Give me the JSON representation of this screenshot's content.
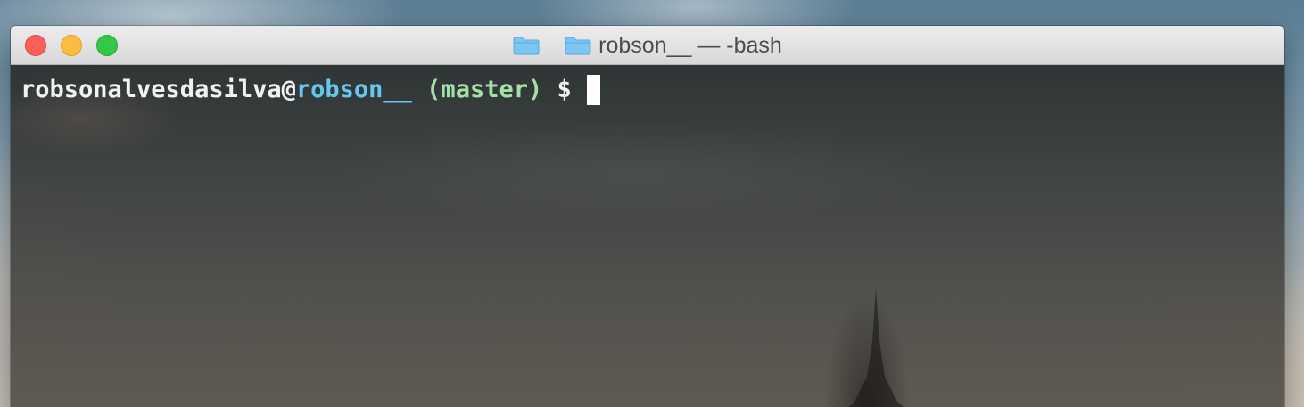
{
  "window": {
    "title": "robson__ — -bash",
    "buttons": {
      "close": "close",
      "minimize": "minimize",
      "zoom": "zoom"
    },
    "icons": {
      "proxy": "folder-icon",
      "title": "folder-icon"
    }
  },
  "prompt": {
    "user": "robsonalvesdasilva",
    "at": "@",
    "host": "robson__",
    "branch": " (master)",
    "symbol": " $ "
  },
  "colors": {
    "host": "#66c7ee",
    "branch": "#a3e0a8",
    "text": "#f2f2f2",
    "folder": "#7cc6f2",
    "close": "#fc605b",
    "minimize": "#fdbc40",
    "zoom": "#34c84a"
  }
}
